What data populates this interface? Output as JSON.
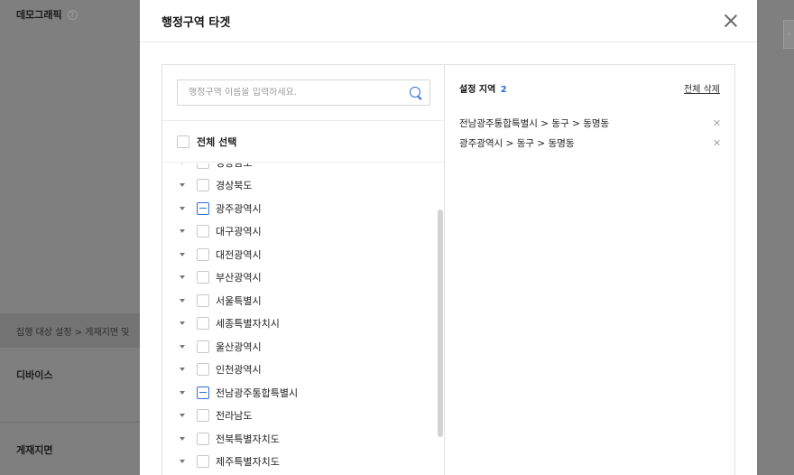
{
  "background": {
    "demographic_title": "데모그래픽",
    "path_text": "집행 대상 설정 > 게재지면 및",
    "device_title": "디바이스",
    "placement_title": "게재지면"
  },
  "modal": {
    "title": "행정구역 타겟",
    "search": {
      "placeholder": "행정구역 이름을 입력하세요.",
      "value": ""
    },
    "select_all_label": "전체 선택",
    "regions": [
      {
        "label": "경상남도",
        "state": "unchecked"
      },
      {
        "label": "경상북도",
        "state": "unchecked"
      },
      {
        "label": "광주광역시",
        "state": "partial"
      },
      {
        "label": "대구광역시",
        "state": "unchecked"
      },
      {
        "label": "대전광역시",
        "state": "unchecked"
      },
      {
        "label": "부산광역시",
        "state": "unchecked"
      },
      {
        "label": "서울특별시",
        "state": "unchecked"
      },
      {
        "label": "세종특별자치시",
        "state": "unchecked"
      },
      {
        "label": "울산광역시",
        "state": "unchecked"
      },
      {
        "label": "인천광역시",
        "state": "unchecked"
      },
      {
        "label": "전남광주통합특별시",
        "state": "partial"
      },
      {
        "label": "전라남도",
        "state": "unchecked"
      },
      {
        "label": "전북특별자치도",
        "state": "unchecked"
      },
      {
        "label": "제주특별자치도",
        "state": "unchecked"
      }
    ],
    "selected": {
      "title": "설정 지역",
      "count": "2",
      "clear_all_label": "전체 삭제",
      "items": [
        "전남광주통합특별시 > 동구 > 동명동",
        "광주광역시 > 동구 > 동명동"
      ]
    }
  },
  "colors": {
    "accent": "#2f6fd6",
    "overlay": "#7f7f7f"
  }
}
